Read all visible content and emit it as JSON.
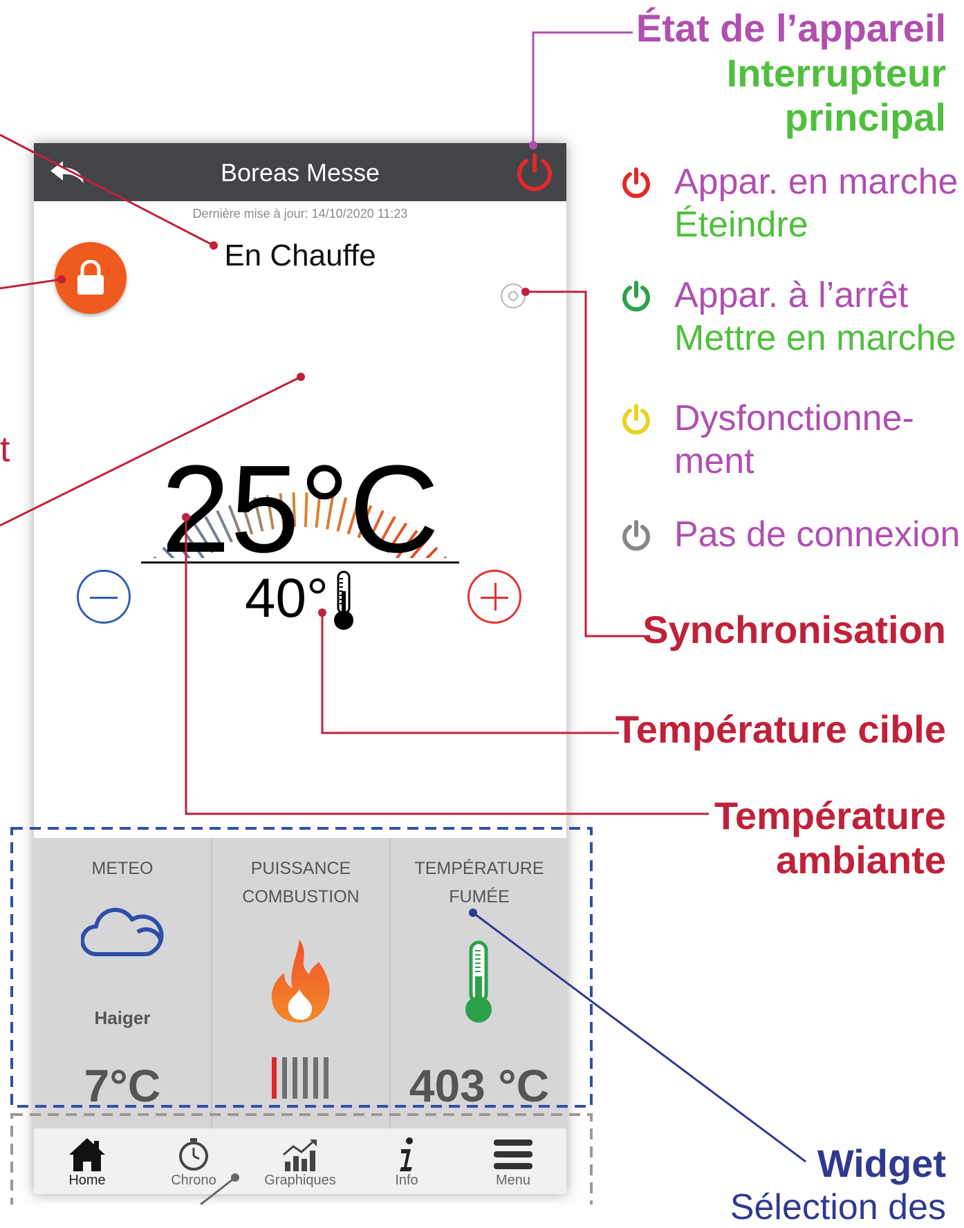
{
  "app": {
    "title": "Boreas Messe",
    "last_update": "Dernière mise à jour: 14/10/2020 11:23",
    "status": "En Chauffe",
    "ambient_temperature": "25°C",
    "target_temperature": "40°"
  },
  "widgets": [
    {
      "title_line1": "METEO",
      "title_line2": "",
      "subtitle": "Haiger",
      "value": "7°C",
      "icon": "cloud-icon"
    },
    {
      "title_line1": "PUISSANCE",
      "title_line2": "COMBUSTION",
      "value": "",
      "icon": "flame-icon",
      "power_level": 1,
      "power_max": 6
    },
    {
      "title_line1": "TEMPÉRATURE",
      "title_line2": "FUMÉE",
      "value": "403 °C",
      "icon": "thermometer-icon"
    }
  ],
  "nav": [
    {
      "label": "Home",
      "icon": "home-icon"
    },
    {
      "label": "Chrono",
      "icon": "stopwatch-icon"
    },
    {
      "label": "Graphiques",
      "icon": "chart-icon"
    },
    {
      "label": "Info",
      "icon": "info-icon"
    },
    {
      "label": "Menu",
      "icon": "menu-icon"
    }
  ],
  "annotations": {
    "device_state_title": "État de l’appareil",
    "main_switch_line1": "Interrupteur",
    "main_switch_line2": "principal",
    "legend": [
      {
        "line1": "Appar. en marche",
        "line2": "Éteindre",
        "icon_color": "#e02a2a"
      },
      {
        "line1": "Appar. à l’arrêt",
        "line2": "Mettre en marche",
        "icon_color": "#2da04a"
      },
      {
        "line1": "Dysfonctionne-",
        "line2": "ment",
        "icon_color": "#e8d420"
      },
      {
        "line1": "Pas de connexion",
        "line2": "",
        "icon_color": "#888888"
      }
    ],
    "sync": "Synchronisation",
    "target_temp": "Température cible",
    "ambient_temp_line1": "Température",
    "ambient_temp_line2": "ambiante",
    "widget": "Widget",
    "widget_sub": "Sélection des",
    "left_fragment": "t"
  },
  "colors": {
    "appbar": "#424448",
    "lock": "#ef5b1e",
    "power": "#e02a2a",
    "purple": "#b04fb0",
    "green": "#4fbf3d",
    "red": "#c0213a",
    "blue": "#2f3a8f"
  }
}
